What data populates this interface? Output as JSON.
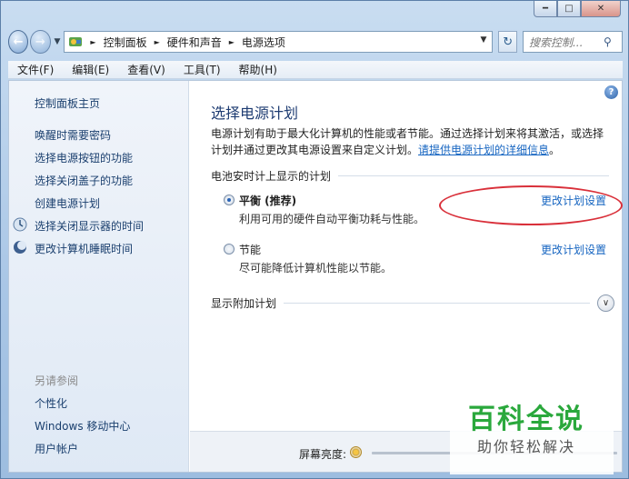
{
  "window": {
    "caption_buttons": {
      "minimize": "minimize-icon",
      "maximize": "maximize-icon",
      "close": "close-icon"
    }
  },
  "address_bar": {
    "breadcrumbs": [
      "控制面板",
      "硬件和声音",
      "电源选项"
    ],
    "search_placeholder": "搜索控制..."
  },
  "menu": [
    "文件(F)",
    "编辑(E)",
    "查看(V)",
    "工具(T)",
    "帮助(H)"
  ],
  "sidebar": {
    "home": "控制面板主页",
    "tasks": [
      {
        "label": "唤醒时需要密码",
        "icon": null
      },
      {
        "label": "选择电源按钮的功能",
        "icon": null
      },
      {
        "label": "选择关闭盖子的功能",
        "icon": null
      },
      {
        "label": "创建电源计划",
        "icon": null
      },
      {
        "label": "选择关闭显示器的时间",
        "icon": "monitor-icon"
      },
      {
        "label": "更改计算机睡眠时间",
        "icon": "moon-icon"
      }
    ],
    "see_also": {
      "heading": "另请参阅",
      "links": [
        "个性化",
        "Windows 移动中心",
        "用户帐户"
      ]
    }
  },
  "main": {
    "title": "选择电源计划",
    "intro_text": "电源计划有助于最大化计算机的性能或者节能。通过选择计划来将其激活，或选择计划并通过更改其电源设置来自定义计划。",
    "intro_link": "请提供电源计划的详细信息",
    "intro_end": "。",
    "section_heading": "电池安时计上显示的计划",
    "plans": [
      {
        "name": "平衡 (推荐)",
        "description": "利用可用的硬件自动平衡功耗与性能。",
        "change_link": "更改计划设置",
        "selected": true
      },
      {
        "name": "节能",
        "description": "尽可能降低计算机性能以节能。",
        "change_link": "更改计划设置",
        "selected": false
      }
    ],
    "extra_plans_heading": "显示附加计划",
    "brightness_label": "屏幕亮度:"
  },
  "watermark": {
    "title": "百科全说",
    "subtitle": "助你轻松解决"
  },
  "colors": {
    "link": "#1665c1",
    "title": "#1e3c72",
    "annotation": "#d9303a",
    "watermark_green": "#2aa83c"
  }
}
